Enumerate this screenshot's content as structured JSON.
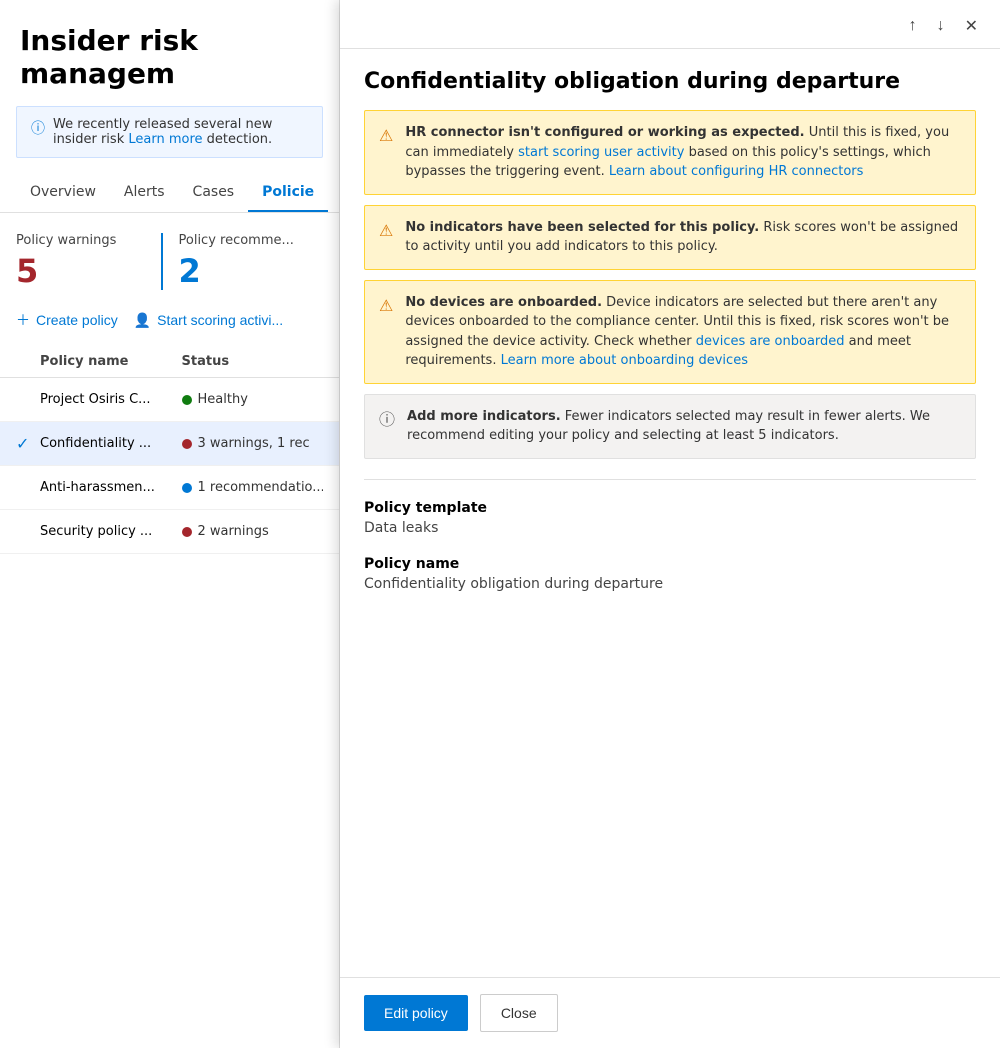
{
  "left": {
    "page_title": "Insider risk managem",
    "info_banner": {
      "text": "We recently released several new insider risk ",
      "link_text": "Learn more",
      "suffix": "detection."
    },
    "nav_tabs": [
      {
        "label": "Overview",
        "active": false
      },
      {
        "label": "Alerts",
        "active": false
      },
      {
        "label": "Cases",
        "active": false
      },
      {
        "label": "Policie",
        "active": true
      }
    ],
    "stats": [
      {
        "label": "Policy warnings",
        "value": "5"
      },
      {
        "label": "Policy recomme...",
        "value": "2"
      }
    ],
    "actions": [
      {
        "label": "Create policy"
      },
      {
        "label": "Start scoring activi..."
      }
    ],
    "table_headers": [
      "Policy name",
      "Status"
    ],
    "policies": [
      {
        "name": "Project Osiris C...",
        "status": "Healthy",
        "dot": "green",
        "selected": false
      },
      {
        "name": "Confidentiality ...",
        "status": "3 warnings, 1 rec",
        "dot": "red",
        "selected": true
      },
      {
        "name": "Anti-harassmen...",
        "status": "1 recommendatio...",
        "dot": "blue",
        "selected": false
      },
      {
        "name": "Security policy ...",
        "status": "2 warnings",
        "dot": "red",
        "selected": false
      }
    ]
  },
  "flyout": {
    "title": "Confidentiality obligation during departure",
    "nav_up_label": "↑",
    "nav_down_label": "↓",
    "close_label": "✕",
    "alerts": [
      {
        "type": "warning",
        "bold_text": "HR connector isn't configured or working as expected.",
        "text": " Until this is fixed, you can immediately ",
        "link1_text": "start scoring user activity",
        "text2": " based on this policy's settings, which bypasses the triggering event. ",
        "link2_text": "Learn about configuring HR connectors"
      },
      {
        "type": "warning",
        "bold_text": "No indicators have been selected for this policy.",
        "text": " Risk scores won't be assigned to activity until you add indicators to this policy."
      },
      {
        "type": "warning",
        "bold_text": "No devices are onboarded.",
        "text": " Device indicators are selected but there aren't any devices onboarded to the compliance center. Until this is fixed, risk scores won't be assigned the device activity. Check whether ",
        "link1_text": "devices are onboarded",
        "text2": " and meet requirements. ",
        "link2_text": "Learn more about onboarding devices"
      },
      {
        "type": "info",
        "bold_text": "Add more indicators.",
        "text": " Fewer indicators selected may result in fewer alerts. We recommend editing your policy and selecting at least 5 indicators."
      }
    ],
    "policy_template_label": "Policy template",
    "policy_template_value": "Data leaks",
    "policy_name_label": "Policy name",
    "policy_name_value": "Confidentiality obligation during departure",
    "footer": {
      "edit_label": "Edit policy",
      "close_label": "Close"
    }
  }
}
